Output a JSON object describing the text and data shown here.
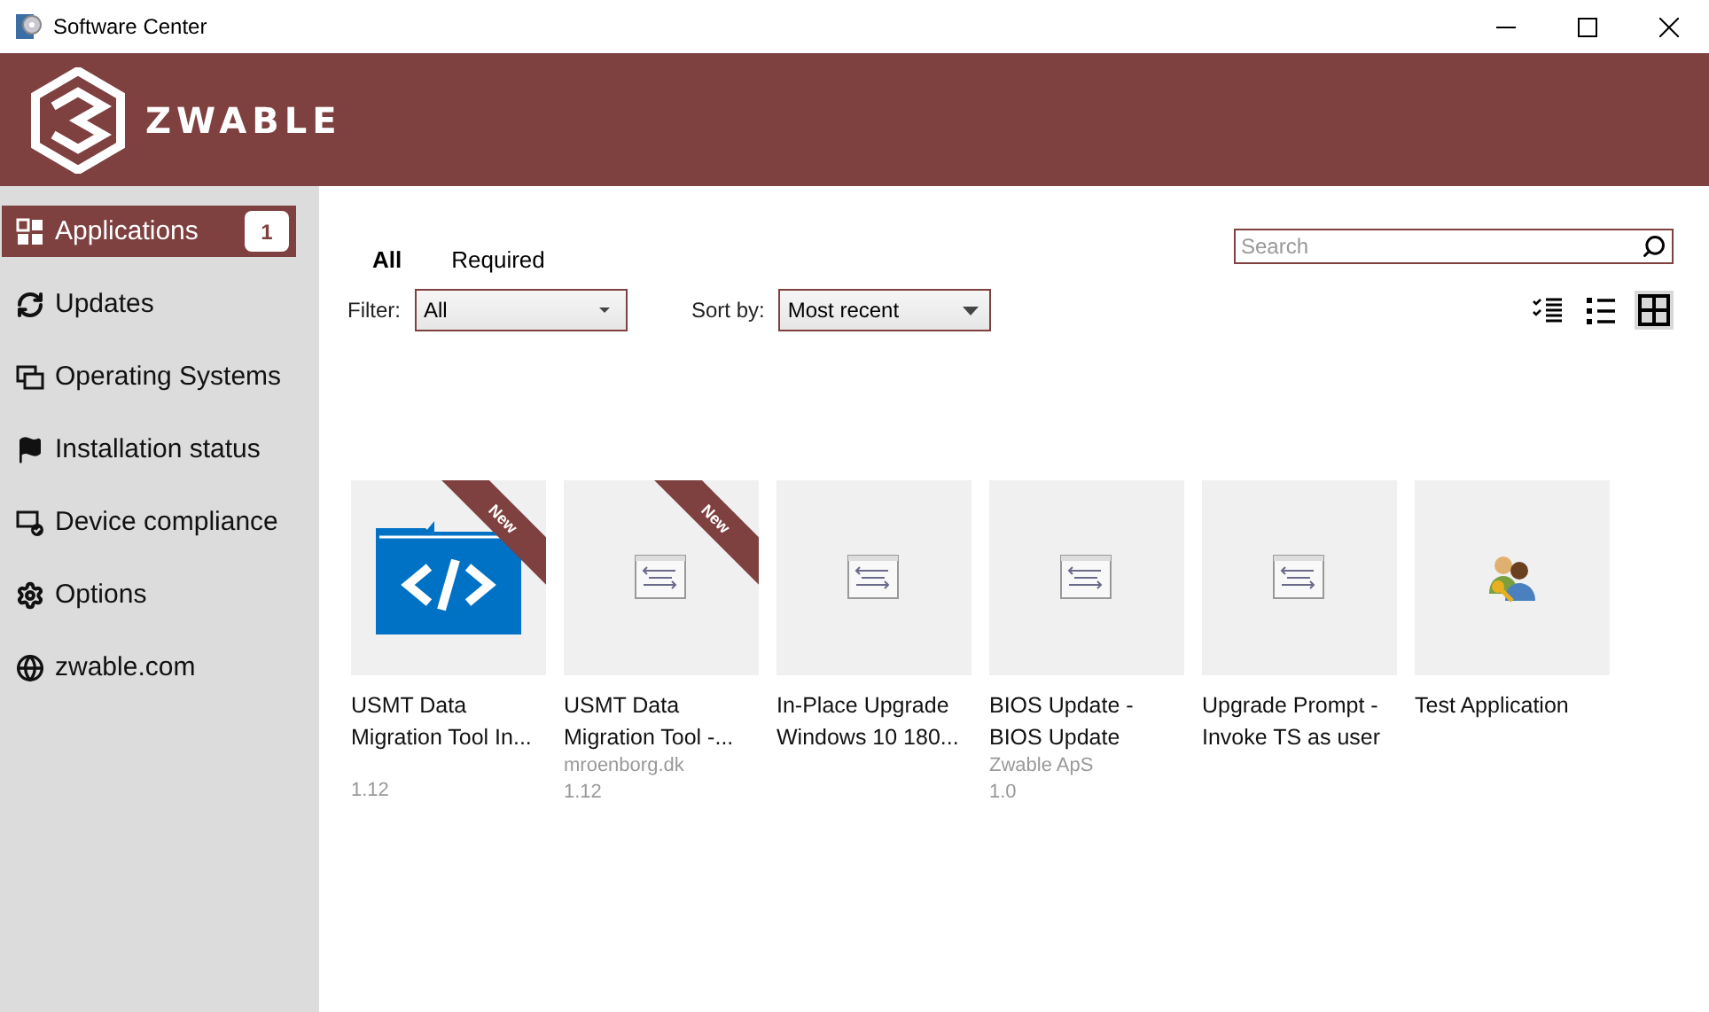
{
  "window": {
    "title": "Software Center"
  },
  "brand": {
    "name": "ZWABLE"
  },
  "sidebar": {
    "items": [
      {
        "label": "Applications",
        "kind": "apps",
        "selected": true,
        "badge": "1"
      },
      {
        "label": "Updates",
        "kind": "refresh",
        "selected": false
      },
      {
        "label": "Operating Systems",
        "kind": "windows",
        "selected": false
      },
      {
        "label": "Installation status",
        "kind": "flag",
        "selected": false
      },
      {
        "label": "Device compliance",
        "kind": "device",
        "selected": false
      },
      {
        "label": "Options",
        "kind": "gear",
        "selected": false
      },
      {
        "label": "zwable.com",
        "kind": "globe",
        "selected": false
      }
    ]
  },
  "tabs": [
    {
      "label": "All",
      "selected": true
    },
    {
      "label": "Required",
      "selected": false
    }
  ],
  "search": {
    "placeholder": "Search"
  },
  "filter": {
    "label": "Filter:",
    "value": "All"
  },
  "sort": {
    "label": "Sort by:",
    "value": "Most recent"
  },
  "views": [
    {
      "kind": "checklist",
      "selected": false
    },
    {
      "kind": "list",
      "selected": false
    },
    {
      "kind": "grid",
      "selected": true
    }
  ],
  "apps": [
    {
      "title": "USMT Data Migration Tool In...",
      "kind": "folder-code",
      "new": true,
      "ribbon": "New",
      "version": "1.12"
    },
    {
      "title": "USMT Data Migration Tool -...",
      "kind": "script",
      "new": true,
      "ribbon": "New",
      "publisher": "mroenborg.dk",
      "version": "1.12"
    },
    {
      "title": "In-Place Upgrade Windows 10 180...",
      "kind": "script",
      "new": false
    },
    {
      "title": "BIOS Update - BIOS Update",
      "kind": "script",
      "new": false,
      "publisher": "Zwable ApS",
      "version": "1.0"
    },
    {
      "title": "Upgrade Prompt - Invoke TS as user",
      "kind": "script",
      "new": false
    },
    {
      "title": "Test Application",
      "kind": "users",
      "new": false
    }
  ]
}
